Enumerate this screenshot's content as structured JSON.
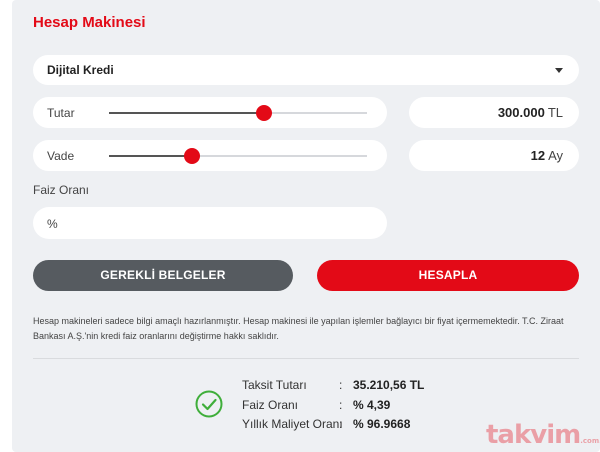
{
  "form": {
    "title": "Hesap Makinesi",
    "loan_type": "Dijital Kredi",
    "amount": {
      "label": "Tutar",
      "value": "300.000",
      "unit": "TL",
      "slider_fraction": 0.6
    },
    "term": {
      "label": "Vade",
      "value": "12",
      "unit": "Ay",
      "slider_fraction": 0.32
    },
    "rate": {
      "label": "Faiz Oranı",
      "placeholder": "%"
    }
  },
  "buttons": {
    "documents": "GEREKLİ BELGELER",
    "calculate": "HESAPLA"
  },
  "disclaimer": "Hesap makineleri sadece bilgi amaçlı hazırlanmıştır. Hesap makinesi ile yapılan işlemler bağlayıcı bir fiyat içermemektedir. T.C. Ziraat Bankası A.Ş.'nin kredi faiz oranlarını değiştirme hakkı saklıdır.",
  "results": [
    {
      "label": "Taksit Tutarı",
      "colon": ":",
      "value": "35.210,56 TL"
    },
    {
      "label": "Faiz Oranı",
      "colon": ":",
      "value": "% 4,39"
    },
    {
      "label": "Yıllık Maliyet Oranı",
      "colon": ":",
      "value": "% 96.9668"
    }
  ],
  "watermark": {
    "text": "takvim",
    "suffix": ".com.tr"
  },
  "colors": {
    "accent": "#e30a17",
    "secondary_button": "#565b60",
    "success": "#3fae3a"
  },
  "icons": {
    "result_status": "check-circle-icon",
    "dropdown": "chevron-down-icon"
  }
}
